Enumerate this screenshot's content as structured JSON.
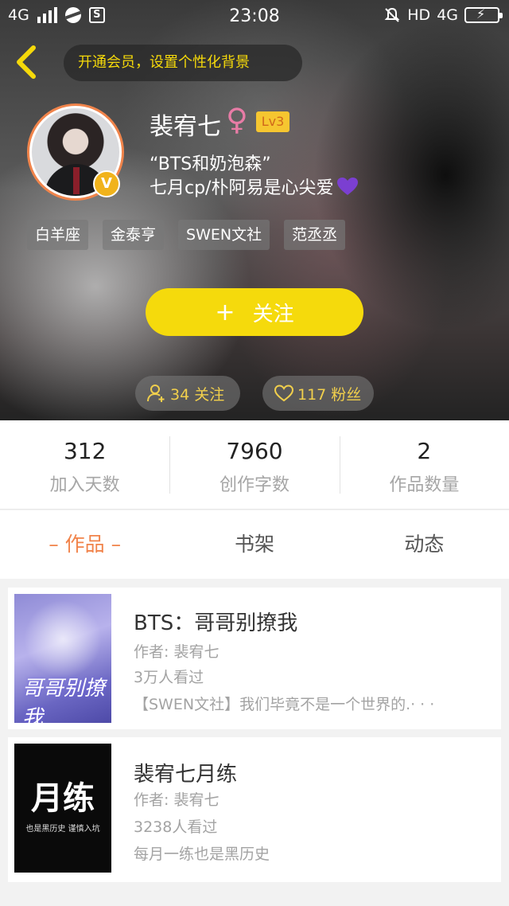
{
  "status_bar": {
    "network": "4G",
    "time": "23:08",
    "hd": "HD",
    "network_right": "4G"
  },
  "header": {
    "vip_banner": "开通会员，设置个性化背景",
    "username": "裴宥七",
    "gender_symbol": "♀",
    "level": "Lv3",
    "verified_badge": "V",
    "bio_line1": "“BTS和奶泡森”",
    "bio_line2": "七月cp/朴阿易是心尖爱",
    "tags": [
      "白羊座",
      "金泰亨",
      "SWEN文社",
      "范丞丞"
    ],
    "follow_button": {
      "plus": "+",
      "label": "关注"
    },
    "following": "34 关注",
    "fans": "117 粉丝"
  },
  "stats": [
    {
      "value": "312",
      "label": "加入天数"
    },
    {
      "value": "7960",
      "label": "创作字数"
    },
    {
      "value": "2",
      "label": "作品数量"
    }
  ],
  "tabs": [
    {
      "label": "– 作品 –",
      "active": true
    },
    {
      "label": "书架",
      "active": false
    },
    {
      "label": "动态",
      "active": false
    }
  ],
  "books": [
    {
      "title": "BTS：哥哥别撩我",
      "author": "作者: 裴宥七",
      "views": "3万人看过",
      "description": "【SWEN文社】我们毕竟不是一个世界的.· · ·",
      "cover_text": "哥哥别撩我"
    },
    {
      "title": "裴宥七月练",
      "author": "作者: 裴宥七",
      "views": "3238人看过",
      "description": "每月一练也是黑历史",
      "cover_text": "月练",
      "cover_subtext": "也是黑历史 谨慎入坑"
    }
  ],
  "colors": {
    "accent_yellow": "#f5da0c",
    "accent_orange": "#f1834a",
    "heart_purple": "#7b3fd1"
  }
}
